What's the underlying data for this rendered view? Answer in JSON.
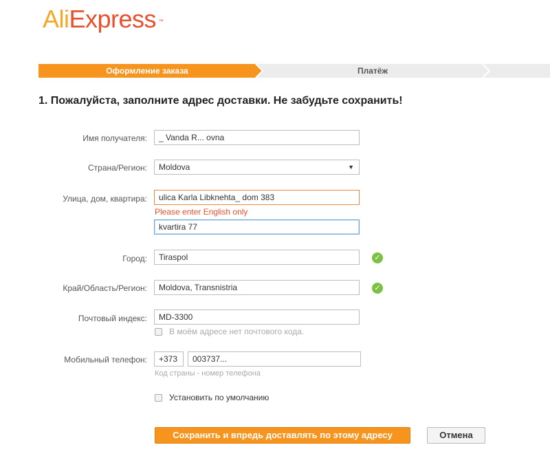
{
  "logo": {
    "part1": "Ali",
    "part2": "Express",
    "tm": "™"
  },
  "steps": [
    {
      "label": "Оформление заказа",
      "active": true
    },
    {
      "label": "Платёж",
      "active": false
    }
  ],
  "title": "1. Пожалуйста, заполните адрес доставки. Не забудьте сохранить!",
  "form": {
    "name_label": "Имя получателя:",
    "name_value": "_              Vanda R... ovna",
    "country_label": "Страна/Регион:",
    "country_value": "Moldova",
    "street_label": "Улица, дом, квартира:",
    "street_value": " ulica  Karla Libknehta_ dom 383",
    "street_error": "Please enter English only",
    "street2_value": "kvartira 77",
    "city_label": "Город:",
    "city_value": "Tiraspol",
    "region_label": "Край/Область/Регион:",
    "region_value": "Moldova, Transnistria",
    "zip_label": "Почтовый индекс:",
    "zip_value": "MD-3300",
    "no_zip_label": "В моём адресе нет почтового кода.",
    "phone_label": "Мобильный телефон:",
    "phone_code": "+373",
    "phone_number": "003737...",
    "phone_hint": "Код страны - номер телефона",
    "default_label": "Установить по умолчанию"
  },
  "buttons": {
    "save": "Сохранить и впредь доставлять по этому адресу",
    "cancel": "Отмена"
  },
  "colors": {
    "brand_orange": "#f7941d",
    "step_active": "#f7941d",
    "step_inactive": "#ececec",
    "error": "#e8502c",
    "valid": "#7cc242"
  },
  "icons": {
    "valid": "check-circle-icon",
    "dropdown": "triangle-down-icon"
  }
}
